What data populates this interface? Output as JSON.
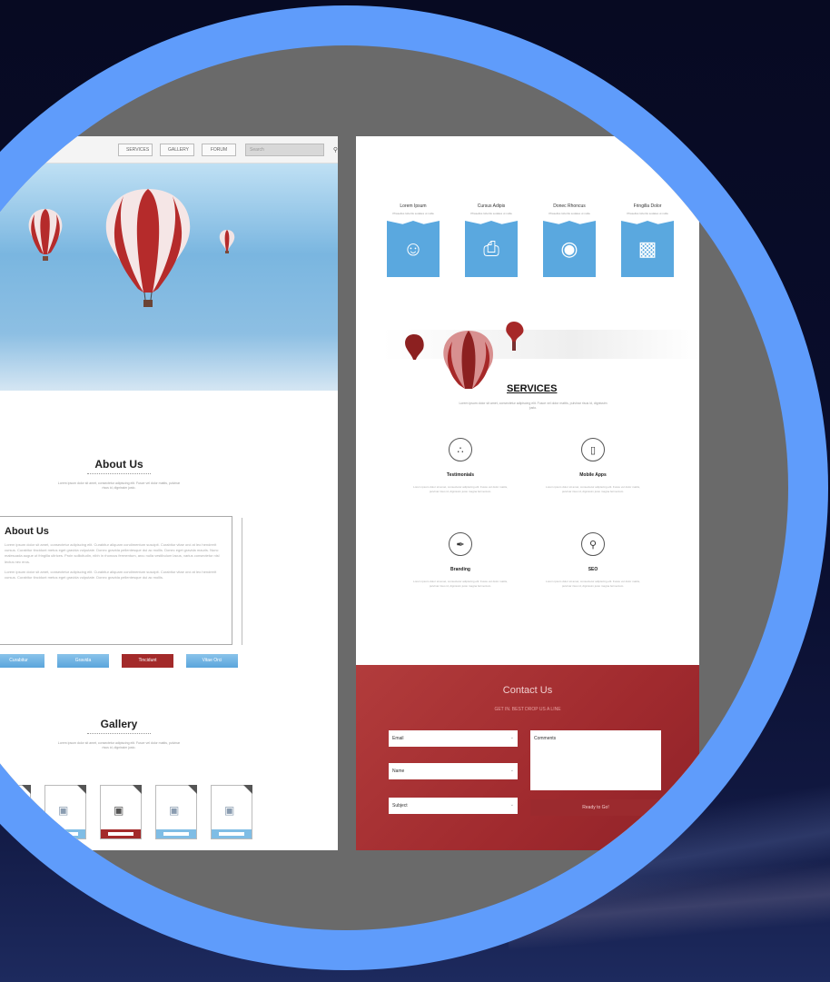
{
  "left_page": {
    "nav": {
      "items": [
        "SERVICES",
        "GALLERY",
        "FORUM"
      ],
      "search_placeholder": "Search",
      "search_icon": "magnifier-icon"
    },
    "about_heading": "About Us",
    "about_intro": "Lorem ipsum dolor sit amet, consectetur adipiscing elit. Fusce vel dolor mattis, pulvinar risus id, dignissim justo.",
    "about_box": {
      "title": "About Us",
      "paragraph_1": "Lorem ipsum dolor sit amet, consectetur adipiscing elit. Curabitur aliquam condimentum suscipit. Curabitur vitae orci at leo hendrerit cursus. Curabitur tincidunt metus eget gravida vulputate. Donec gravida pellentesque dui ac mollis. Donec eget gravida mauris. Nunc malesuada augue ut fringilla ultrices. Proin sollicitudin, nibh in rhoncus fermentum, arcu nulla vestibulum lacus, varius consectetur nisl lectus nec eros.",
      "paragraph_2": "Lorem ipsum dolor sit amet, consectetur adipiscing elit. Curabitur aliquam condimentum suscipit. Curabitur vitae orci at leo hendrerit cursus. Curabitur tincidunt metus eget gravida vulputate. Donec gravida pellentesque dui ac mollis."
    },
    "tabs": [
      {
        "label": "Curabitur",
        "active": false
      },
      {
        "label": "Gravida",
        "active": false
      },
      {
        "label": "Tincidunt",
        "active": true
      },
      {
        "label": "Vitae Orci",
        "active": false
      }
    ],
    "gallery_heading": "Gallery",
    "gallery_intro": "Lorem ipsum dolor sit amet, consectetur adipiscing elit. Fusce vel dolor mattis, pulvinar risus id, dignissim justo.",
    "gallery_icon": "camera-icon",
    "active_gallery_index": 2
  },
  "right_page": {
    "features": [
      {
        "title": "Lorem Ipsum",
        "sub": "Phasellus lobortis sodales ut nulla"
      },
      {
        "title": "Cursus Adipis",
        "sub": "Phasellus lobortis sodales ut nulla"
      },
      {
        "title": "Donec Rhoncus",
        "sub": "Phasellus lobortis sodales ut nulla"
      },
      {
        "title": "Fringilla Dolor",
        "sub": "Phasellus lobortis sodales ut nulla"
      }
    ],
    "services_heading": "SERVICES",
    "services_intro": "Lorem ipsum dolor sit amet, consectetur adipiscing elit. Fusce vel dolor mattis, pulvinar risus id, dignissim justo.",
    "services": [
      {
        "label": "Testimonials",
        "icon": "share-icon",
        "text": "Lorem ipsum dolor sit amet, consectetur adipiscing elit. Fusce vel dolor mattis, pulvinar risus id, dignissim justo magna fermentum."
      },
      {
        "label": "Mobile Apps",
        "icon": "phone-icon",
        "text": "Lorem ipsum dolor sit amet, consectetur adipiscing elit. Fusce vel dolor mattis, pulvinar risus id, dignissim justo magna fermentum."
      },
      {
        "label": "Branding",
        "icon": "pen-icon",
        "text": "Lorem ipsum dolor sit amet, consectetur adipiscing elit. Fusce vel dolor mattis, pulvinar risus id, dignissim justo magna fermentum."
      },
      {
        "label": "SEO",
        "icon": "search-icon",
        "text": "Lorem ipsum dolor sit amet, consectetur adipiscing elit. Fusce vel dolor mattis, pulvinar risus id, dignissim justo magna fermentum."
      }
    ],
    "contact": {
      "title": "Contact Us",
      "subtitle": "GET IN. BEST DROP US A LINE",
      "email_label": "Email",
      "name_label": "Name",
      "subject_label": "Subject",
      "comments_label": "Comments",
      "send_label": "Ready to Go!"
    }
  },
  "colors": {
    "ring": "#5f9cfb",
    "accent_blue": "#5aa8df",
    "accent_red": "#a32a2a",
    "backdrop": "#070a22"
  }
}
